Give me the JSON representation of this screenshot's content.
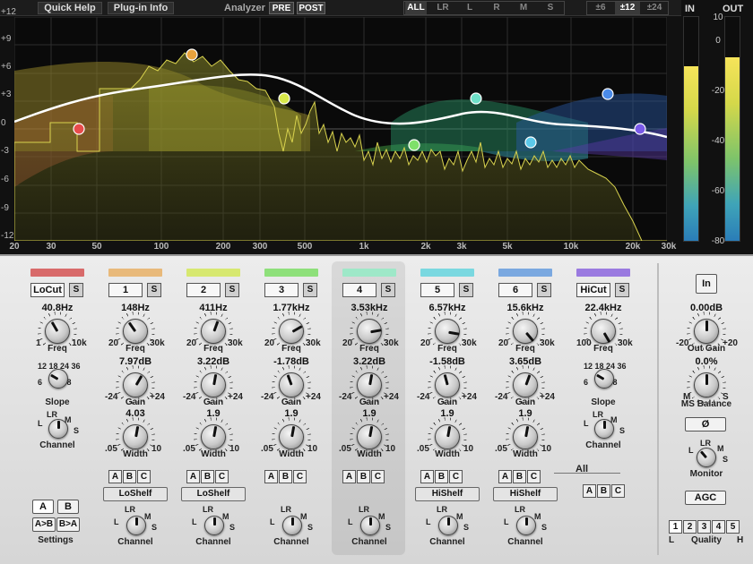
{
  "topbar": {
    "quick_help": "Quick Help",
    "plugin_info": "Plug-in Info",
    "analyzer_label": "Analyzer",
    "pre": "PRE",
    "post": "POST",
    "channel_modes": [
      "ALL",
      "LR",
      "L",
      "R",
      "M",
      "S"
    ],
    "ranges": [
      "±6",
      "±12",
      "±24"
    ]
  },
  "graph": {
    "y_labels": [
      "+12",
      "+9",
      "+6",
      "+3",
      "0",
      "-3",
      "-6",
      "-9",
      "-12"
    ],
    "x_labels": [
      "20",
      "30",
      "50",
      "100",
      "200",
      "300",
      "500",
      "1k",
      "2k",
      "3k",
      "5k",
      "10k",
      "20k",
      "30k"
    ],
    "node_colors": [
      "#e84c4c",
      "#e8a23c",
      "#d7e84a",
      "#7fe06a",
      "#6ee0c8",
      "#5cc8e8",
      "#4a8ae8",
      "#7a5ae8"
    ],
    "colors": {
      "curve": "#ffffff",
      "spectrum": "#c9c44a",
      "grid": "#2d2d2d"
    }
  },
  "meters": {
    "in_label": "IN",
    "out_label": "OUT",
    "scale": [
      "0",
      "-20",
      "-40",
      "-60",
      "-80"
    ],
    "out_top": "10",
    "in_level": 0.78,
    "out_level": 0.82
  },
  "bands": [
    {
      "name": "LoCut",
      "s": "S",
      "freq": "40.8Hz",
      "freq_lo": "1",
      "freq_hi": "10k",
      "freq_label": "Freq",
      "second_label": "Slope",
      "second_value": "",
      "slope_ticks": "12 18 24 36 48 6",
      "third_label": "Channel",
      "third_value": "",
      "channel": "Channel",
      "color": "#d86a6a"
    },
    {
      "name": "1",
      "s": "S",
      "freq": "148Hz",
      "freq_lo": "20",
      "freq_hi": "30k",
      "freq_label": "Freq",
      "gain": "7.97dB",
      "gain_label": "Gain",
      "width": "4.03",
      "width_label": "Width",
      "width_lo": ".05",
      "width_hi": "10",
      "abc": [
        "A",
        "B",
        "C"
      ],
      "shelf": "LoShelf",
      "channel": "Channel",
      "color": "#e8b97a"
    },
    {
      "name": "2",
      "s": "S",
      "freq": "411Hz",
      "freq_lo": "20",
      "freq_hi": "30k",
      "freq_label": "Freq",
      "gain": "3.22dB",
      "gain_label": "Gain",
      "width": "1.9",
      "width_label": "Width",
      "width_lo": ".05",
      "width_hi": "10",
      "abc": [
        "A",
        "B",
        "C"
      ],
      "shelf": "LoShelf",
      "channel": "Channel",
      "color": "#d7e870"
    },
    {
      "name": "3",
      "s": "S",
      "freq": "1.77kHz",
      "freq_lo": "20",
      "freq_hi": "30k",
      "freq_label": "Freq",
      "gain": "-1.78dB",
      "gain_label": "Gain",
      "width": "1.9",
      "width_label": "Width",
      "width_lo": ".05",
      "width_hi": "10",
      "abc": [
        "A",
        "B",
        "C"
      ],
      "channel": "Channel",
      "color": "#8ee07a"
    },
    {
      "name": "4",
      "s": "S",
      "freq": "3.53kHz",
      "freq_lo": "20",
      "freq_hi": "30k",
      "freq_label": "Freq",
      "gain": "3.22dB",
      "gain_label": "Gain",
      "width": "1.9",
      "width_label": "Width",
      "width_lo": ".05",
      "width_hi": "10",
      "abc": [
        "A",
        "B",
        "C"
      ],
      "channel": "Channel",
      "color": "#9ee8c8"
    },
    {
      "name": "5",
      "s": "S",
      "freq": "6.57kHz",
      "freq_lo": "20",
      "freq_hi": "30k",
      "freq_label": "Freq",
      "gain": "-1.58dB",
      "gain_label": "Gain",
      "width": "1.9",
      "width_label": "Width",
      "width_lo": ".05",
      "width_hi": "10",
      "abc": [
        "A",
        "B",
        "C"
      ],
      "shelf": "HiShelf",
      "channel": "Channel",
      "color": "#7ad8e0"
    },
    {
      "name": "6",
      "s": "S",
      "freq": "15.6kHz",
      "freq_lo": "20",
      "freq_hi": "30k",
      "freq_label": "Freq",
      "gain": "3.65dB",
      "gain_label": "Gain",
      "width": "1.9",
      "width_label": "Width",
      "width_lo": ".05",
      "width_hi": "10",
      "abc": [
        "A",
        "B",
        "C"
      ],
      "shelf": "HiShelf",
      "channel": "Channel",
      "color": "#7aa8e0"
    },
    {
      "name": "HiCut",
      "s": "S",
      "freq": "22.4kHz",
      "freq_lo": "100",
      "freq_hi": "30k",
      "freq_label": "Freq",
      "second_label": "Slope",
      "slope_ticks": "12 18 24 36 48 6",
      "third_label": "Channel",
      "color": "#9a7ae0"
    }
  ],
  "all_group": {
    "label": "All",
    "abc": [
      "A",
      "B",
      "C"
    ]
  },
  "settings": {
    "a": "A",
    "b": "B",
    "a_to_b": "A>B",
    "b_to_a": "B>A",
    "label": "Settings"
  },
  "channel_ticks": {
    "lr": "LR",
    "l": "L",
    "r": "R",
    "m": "M",
    "s": "S"
  },
  "right": {
    "in_button": "In",
    "out_gain_value": "0.00dB",
    "out_gain_label": "Out Gain",
    "out_gain_lo": "-20",
    "out_gain_hi": "+20",
    "ms_value": "0.0%",
    "ms_label": "MS Balance",
    "ms_lo": "M",
    "ms_hi": "S",
    "phase": "Ø",
    "monitor_label": "Monitor",
    "agc": "AGC",
    "quality_buttons": [
      "1",
      "2",
      "3",
      "4",
      "5"
    ],
    "quality_label": "Quality",
    "quality_lo": "L",
    "quality_hi": "H"
  }
}
